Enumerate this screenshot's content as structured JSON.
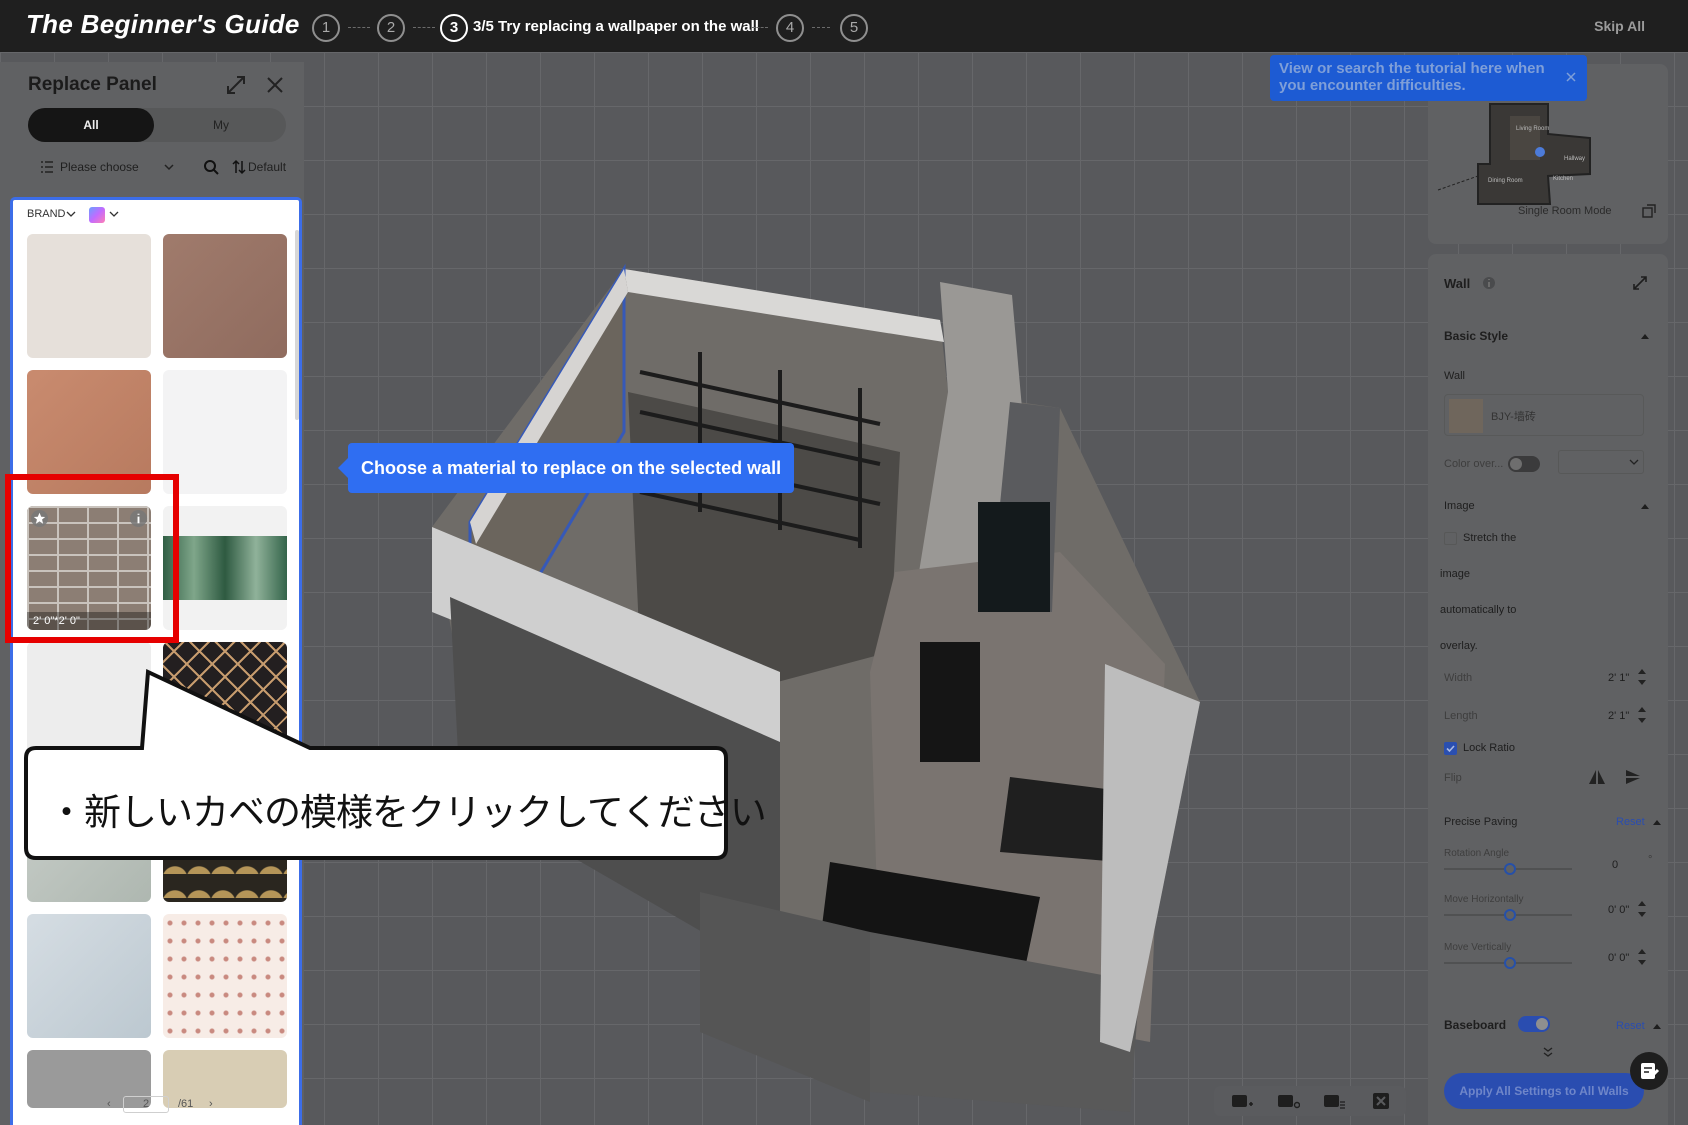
{
  "guide": {
    "title": "The Beginner's Guide",
    "steps": [
      "1",
      "2",
      "3",
      "4",
      "5"
    ],
    "current_step_text": "3/5 Try replacing a wallpaper on the wall",
    "skip_label": "Skip All"
  },
  "replace_panel": {
    "title": "Replace Panel",
    "tabs": {
      "all": "All",
      "my": "My"
    },
    "category_placeholder": "Please choose",
    "sort_label": "Default",
    "brand_label": "BRAND",
    "brick_tile_size": "2' 0\"*2' 0\"",
    "pager": {
      "current": "2",
      "total": "/61"
    }
  },
  "tooltip": {
    "text": "Choose a material to replace on the selected wall"
  },
  "callout": {
    "text": "・新しいカベの模様をクリックしてください"
  },
  "minimap": {
    "hint": "View or search the tutorial here when you encounter difficulties.",
    "rooms": [
      "Living Room",
      "Hallway",
      "Dining Room",
      "Kitchen"
    ],
    "mode_label": "Single Room Mode"
  },
  "wall_panel": {
    "title": "Wall",
    "basic_style": "Basic Style",
    "wall_label": "Wall",
    "material_name": "BJY-墙砖",
    "color_override_label": "Color over...",
    "image_label": "Image",
    "stretch_lines": [
      "Stretch the",
      "image",
      "automatically to",
      "overlay."
    ],
    "width_label": "Width",
    "width_value": "2' 1\"",
    "length_label": "Length",
    "length_value": "2' 1\"",
    "lock_ratio_label": "Lock Ratio",
    "flip_label": "Flip",
    "precise_paving_label": "Precise Paving",
    "reset_label": "Reset",
    "rotation_label": "Rotation Angle",
    "rotation_value": "0",
    "rotation_unit": "°",
    "move_h_label": "Move Horizontally",
    "move_h_value": "0' 0\"",
    "move_v_label": "Move Vertically",
    "move_v_value": "0' 0\"",
    "baseboard_label": "Baseboard",
    "apply_label": "Apply All Settings to All Walls"
  },
  "colors": {
    "accent_blue": "#2f6ef2",
    "highlight_red": "#e60000",
    "topbar": "#1f1f1f"
  }
}
